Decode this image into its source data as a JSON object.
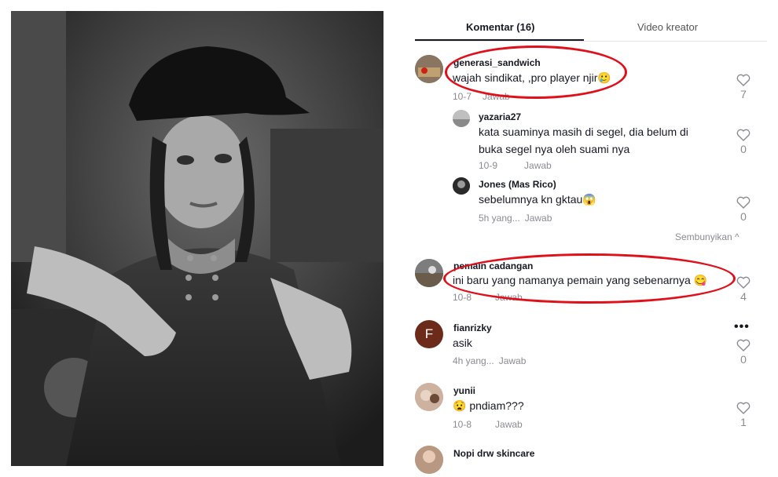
{
  "tabs": {
    "comments": "Komentar (16)",
    "creator_videos": "Video kreator"
  },
  "comments": [
    {
      "user": "generasi_sandwich",
      "text": "wajah sindikat, ,pro player njir",
      "date": "10-7",
      "reply": "Jawab",
      "likes": "7"
    },
    {
      "user": "yazaria27",
      "text": "kata suaminya masih di segel, dia belum di buka segel nya oleh suami nya",
      "date": "10-9",
      "reply": "Jawab",
      "likes": "0"
    },
    {
      "user": "Jones (Mas Rico)",
      "text": "sebelumnya kn gktau",
      "date": "5h yang...",
      "reply": "Jawab",
      "likes": "0"
    },
    {
      "user": "pemain cadangan",
      "text": "ini baru yang namanya pemain yang sebenarnya",
      "date": "10-8",
      "reply": "Jawab",
      "likes": "4"
    },
    {
      "user": "fianrizky",
      "initial": "F",
      "text": "asik",
      "date": "4h yang...",
      "reply": "Jawab",
      "likes": "0"
    },
    {
      "user": "yunii",
      "text": "pndiam???",
      "date": "10-8",
      "reply": "Jawab",
      "likes": "1"
    },
    {
      "user": "Nopi drw skincare",
      "text": "",
      "date": "",
      "reply": "",
      "likes": ""
    }
  ],
  "hide_replies": "Sembunyikan ^",
  "more_label": "•••",
  "emoji": {
    "c1": "🥲",
    "c3": "😱",
    "c4": "😋",
    "c6": "😧"
  },
  "colors": {
    "annotation_red": "#e0101a",
    "text_primary": "#161823",
    "text_secondary": "#8a8b91",
    "avatar_f": "#6b2a1a"
  }
}
